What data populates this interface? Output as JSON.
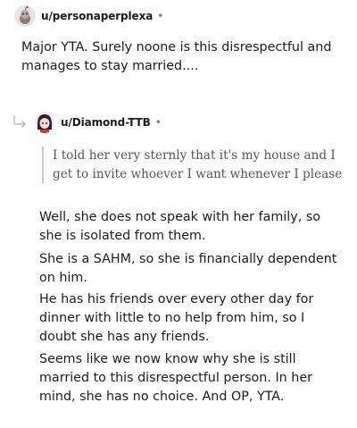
{
  "comments": [
    {
      "username": "u/personaperplexa",
      "separator": "•",
      "avatar_icon": "snoo-avatar-icon",
      "body": "Major YTA. Surely noone is this disrespectful and manages to stay married...."
    },
    {
      "username": "u/Diamond-TTB",
      "separator": "•",
      "avatar_icon": "anime-girl-avatar-icon",
      "reply_icon": "reply-arrow-icon",
      "quote": "I told her very sternly that it's my house and I get to invite whoever I want whenever I please",
      "paragraphs": [
        "Well, she does not speak with her family, so she is isolated from them.",
        "She is a SAHM, so she is financially dependent on him.",
        "He has his friends over every other day for dinner with little to no help from him, so I doubt she has any friends.",
        "Seems like we now know why she is still married to this disrespectful person. In her mind, she has no choice. And OP, YTA."
      ]
    }
  ]
}
